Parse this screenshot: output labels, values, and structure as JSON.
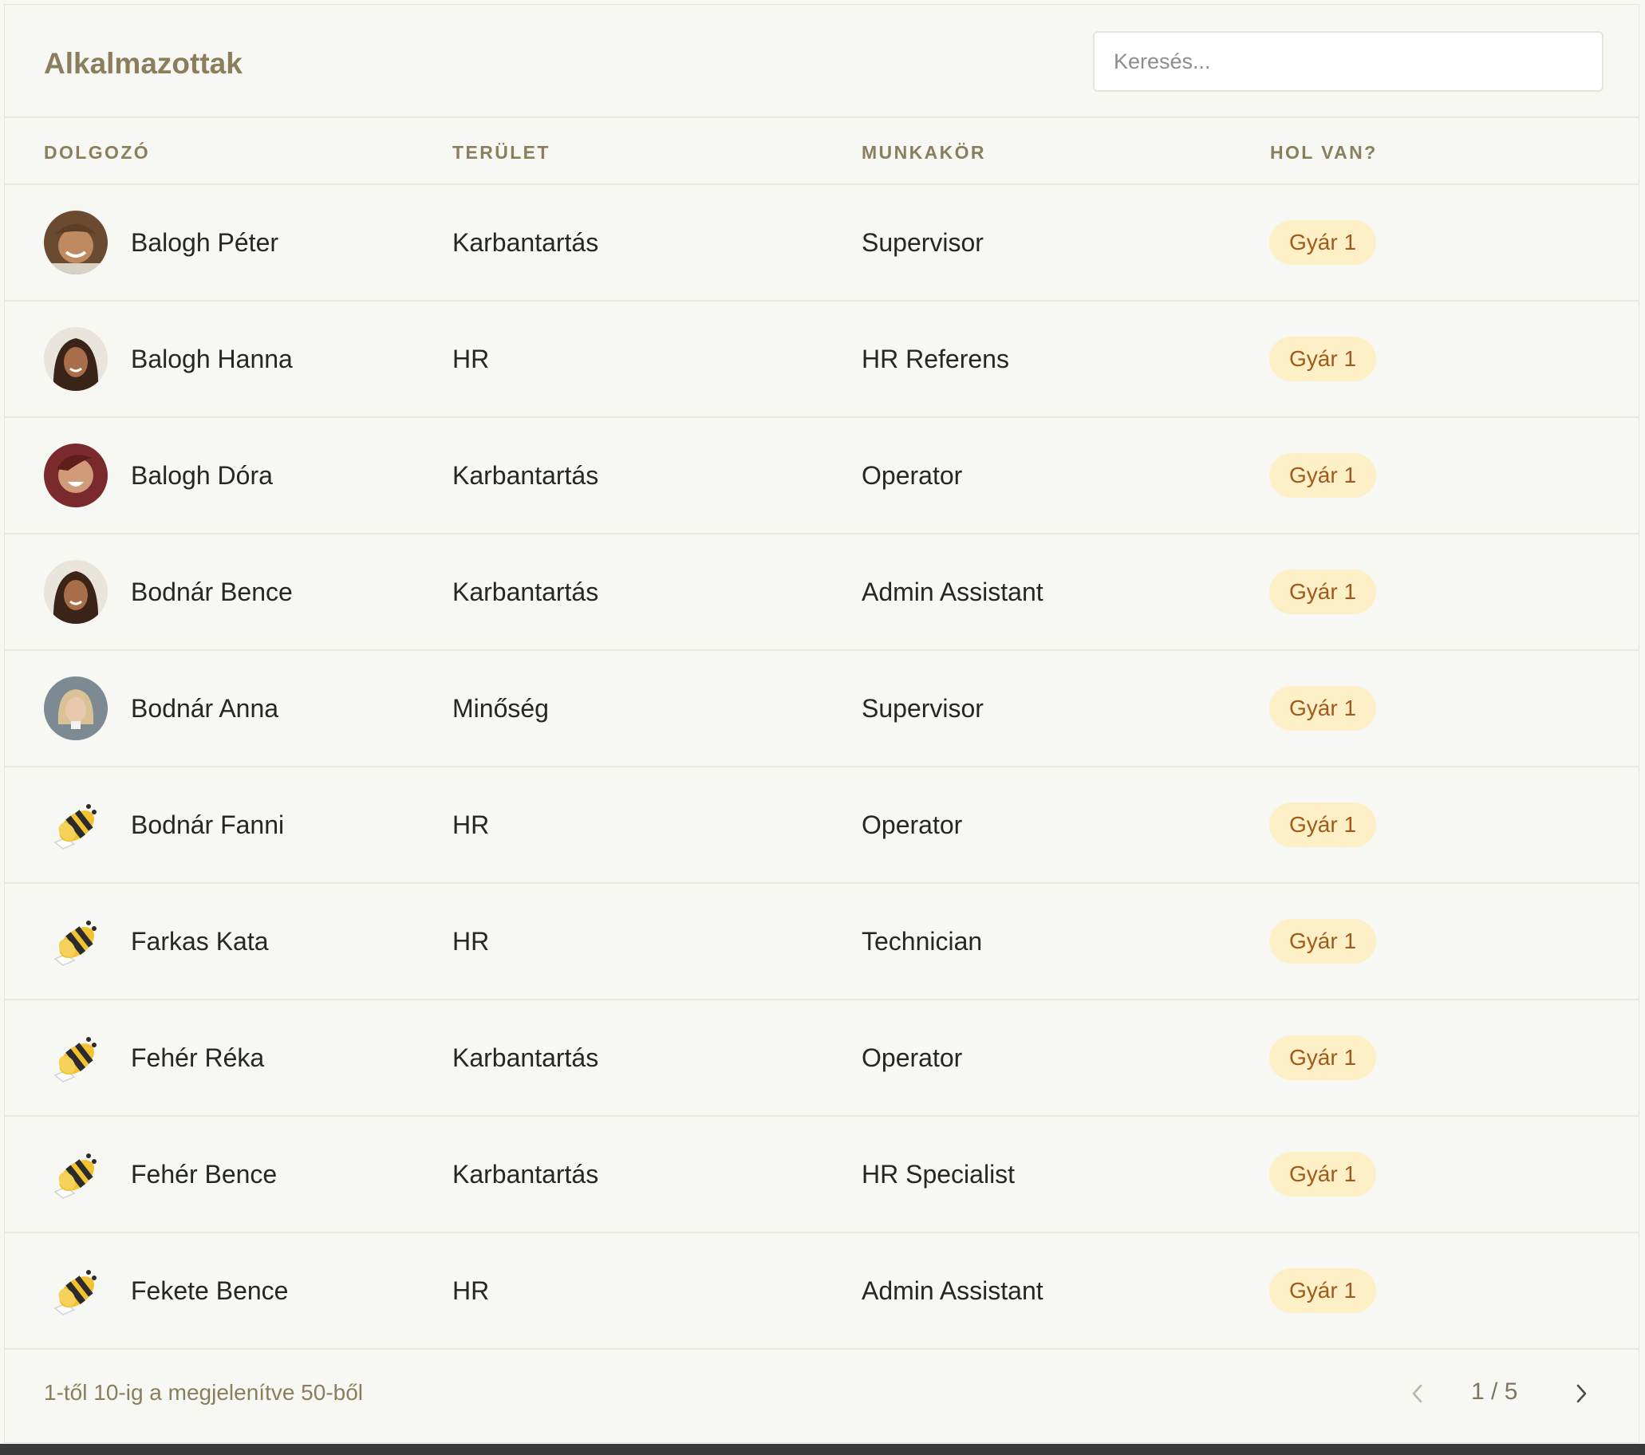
{
  "header": {
    "title": "Alkalmazottak",
    "search_placeholder": "Keresés..."
  },
  "table": {
    "columns": [
      "DOLGOZÓ",
      "TERÜLET",
      "MUNKAKÖR",
      "HOL VAN?"
    ],
    "rows": [
      {
        "name": "Balogh Péter",
        "area": "Karbantartás",
        "role": "Supervisor",
        "location": "Gyár 1",
        "avatar": "photo-man-smiling"
      },
      {
        "name": "Balogh Hanna",
        "area": "HR",
        "role": "HR Referens",
        "location": "Gyár 1",
        "avatar": "photo-woman-dark-hair"
      },
      {
        "name": "Balogh Dóra",
        "area": "Karbantartás",
        "role": "Operator",
        "location": "Gyár 1",
        "avatar": "photo-woman-laughing"
      },
      {
        "name": "Bodnár Bence",
        "area": "Karbantartás",
        "role": "Admin Assistant",
        "location": "Gyár 1",
        "avatar": "photo-woman-dark-hair"
      },
      {
        "name": "Bodnár Anna",
        "area": "Minőség",
        "role": "Supervisor",
        "location": "Gyár 1",
        "avatar": "photo-woman-blonde"
      },
      {
        "name": "Bodnár Fanni",
        "area": "HR",
        "role": "Operator",
        "location": "Gyár 1",
        "avatar": "bee-icon"
      },
      {
        "name": "Farkas Kata",
        "area": "HR",
        "role": "Technician",
        "location": "Gyár 1",
        "avatar": "bee-icon"
      },
      {
        "name": "Fehér Réka",
        "area": "Karbantartás",
        "role": "Operator",
        "location": "Gyár 1",
        "avatar": "bee-icon"
      },
      {
        "name": "Fehér Bence",
        "area": "Karbantartás",
        "role": "HR Specialist",
        "location": "Gyár 1",
        "avatar": "bee-icon"
      },
      {
        "name": "Fekete Bence",
        "area": "HR",
        "role": "Admin Assistant",
        "location": "Gyár 1",
        "avatar": "bee-icon"
      }
    ]
  },
  "footer": {
    "summary": "1-től 10-ig a megjelenítve 50-ből",
    "page_info": "1 / 5",
    "prev_icon": "chevron-left-icon",
    "next_icon": "chevron-right-icon"
  },
  "colors": {
    "accent": "#8a7e5c",
    "badge_bg": "#fdf0c7",
    "badge_text": "#a2591a",
    "background": "#f7f7f4"
  }
}
